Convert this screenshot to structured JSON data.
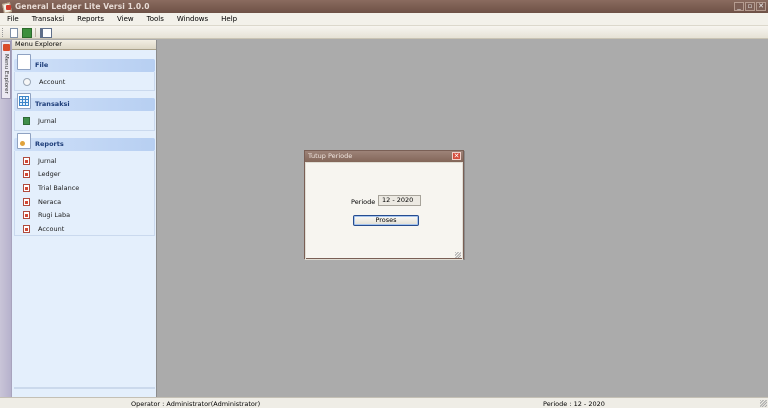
{
  "window": {
    "title": "General Ledger Lite Versi 1.0.0",
    "buttons": [
      "_",
      "▫",
      "✕"
    ]
  },
  "menubar": {
    "items": [
      "File",
      "Transaksi",
      "Reports",
      "View",
      "Tools",
      "Windows",
      "Help"
    ]
  },
  "side_tab": {
    "label": "Menu Explorer"
  },
  "explorer": {
    "header": "Menu Explorer",
    "groups": [
      {
        "title": "File",
        "items": [
          "Account"
        ]
      },
      {
        "title": "Transaksi",
        "items": [
          "Jurnal"
        ]
      },
      {
        "title": "Reports",
        "items": [
          "Jurnal",
          "Ledger",
          "Trial Balance",
          "Neraca",
          "Rugi Laba",
          "Account"
        ]
      }
    ]
  },
  "dialog": {
    "title": "Tutup Periode",
    "close": "✕",
    "periode_label": "Periode",
    "periode_value": "12 - 2020",
    "button": "Proses"
  },
  "statusbar": {
    "operator": "Operator : Administrator(Administrator)",
    "periode": "Periode : 12 - 2020"
  }
}
